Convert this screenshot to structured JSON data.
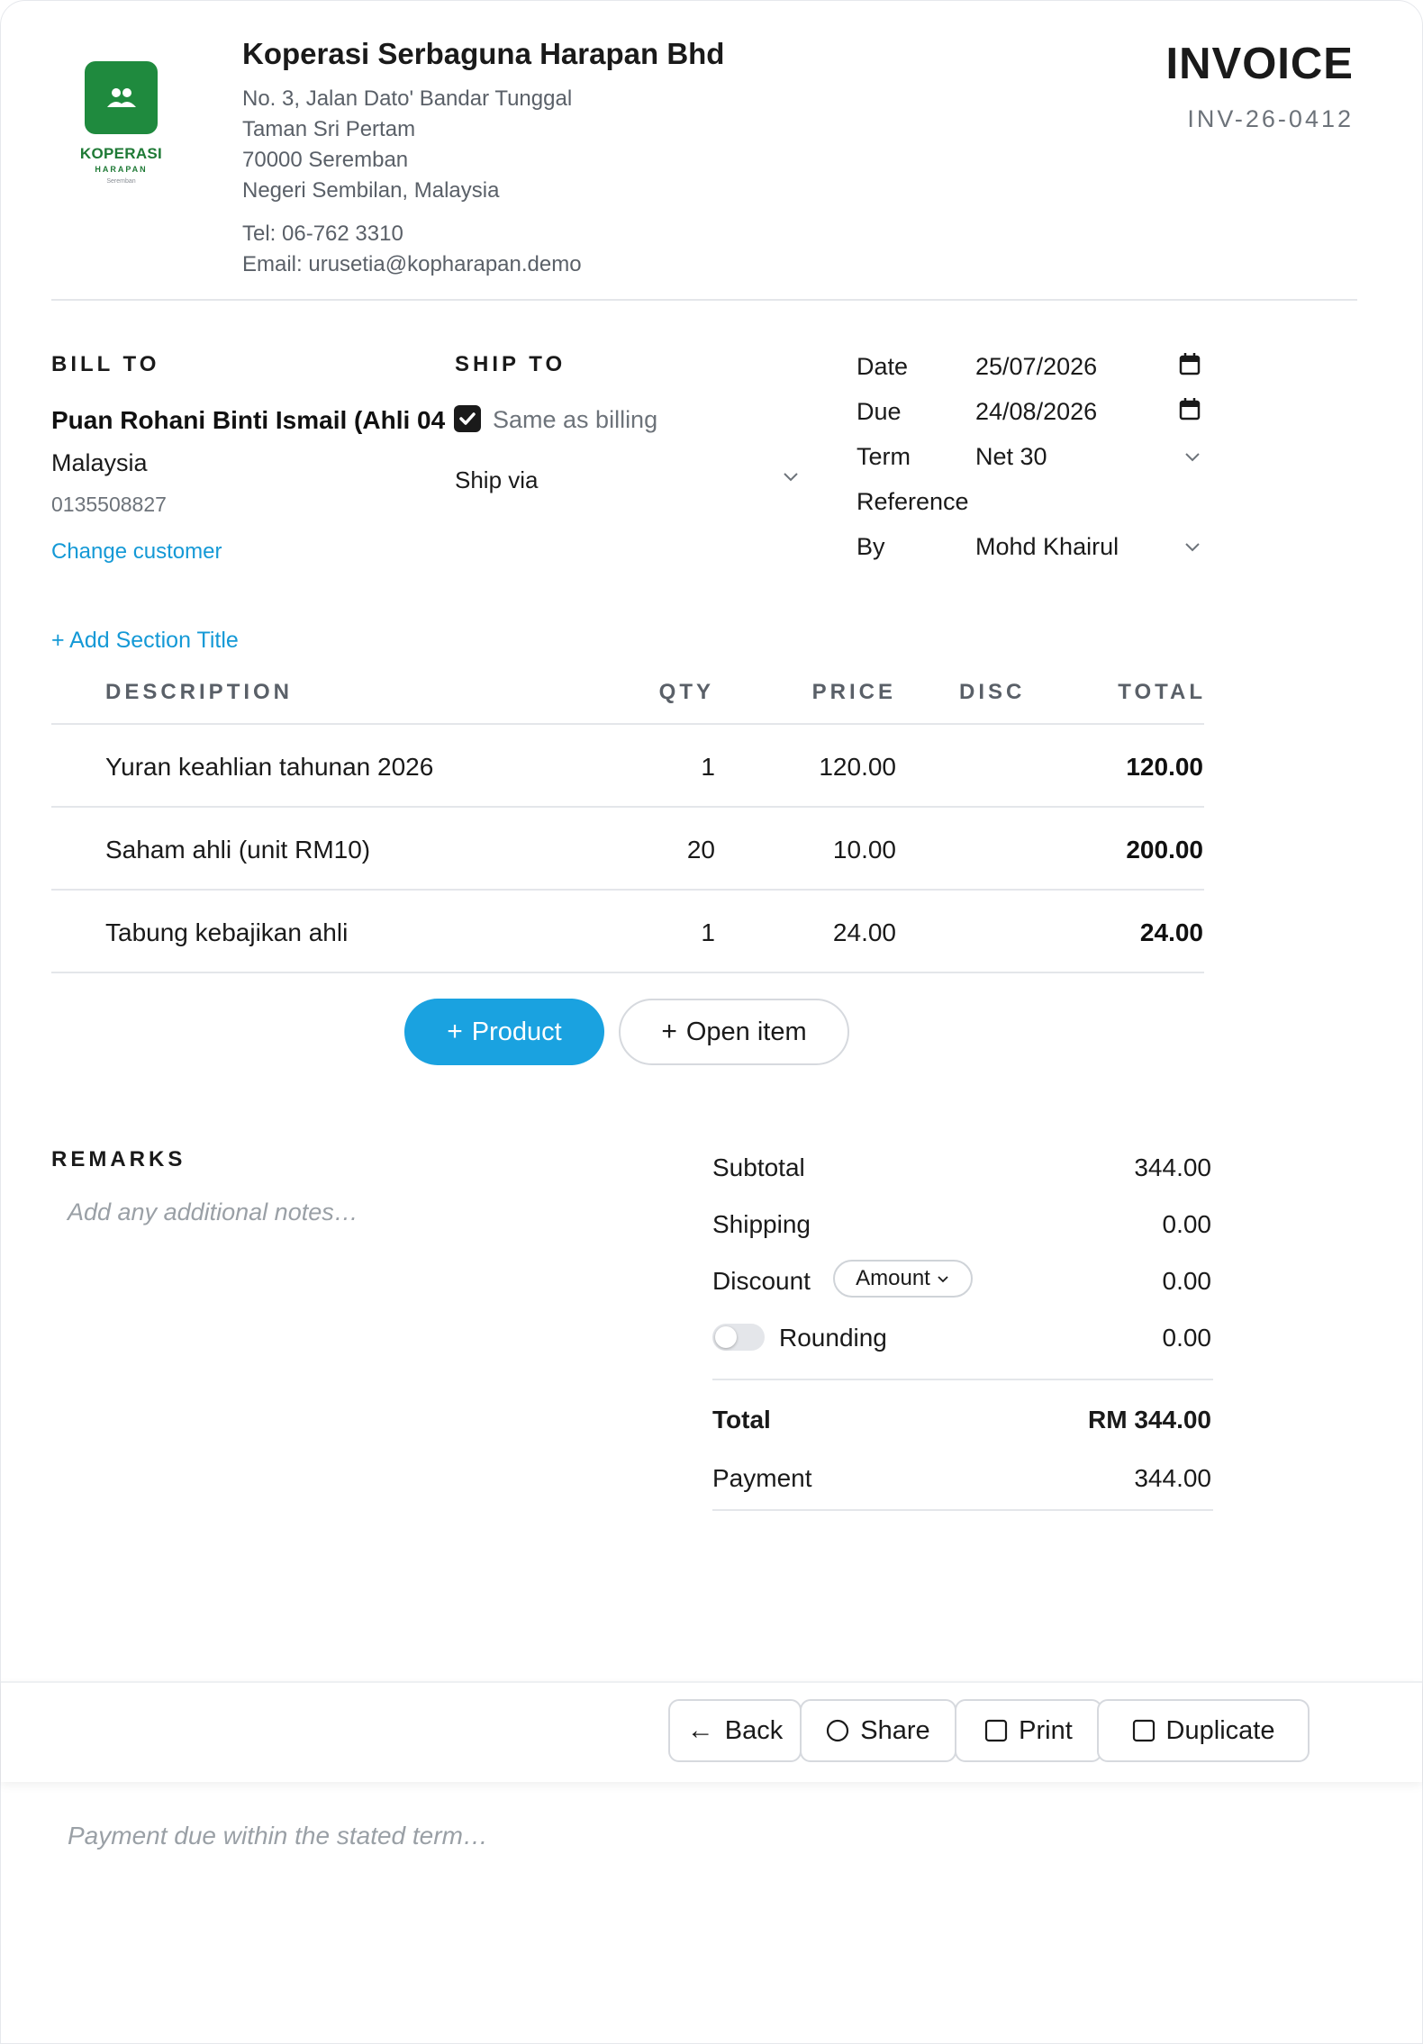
{
  "company": {
    "logo_name": "KOPERASI",
    "logo_sub": "HARAPAN",
    "logo_city": "Seremban",
    "name": "Koperasi Serbaguna Harapan Bhd",
    "address": [
      "No. 3, Jalan Dato' Bandar Tunggal",
      "Taman Sri Pertam",
      "70000 Seremban",
      "Negeri Sembilan, Malaysia"
    ],
    "tel": "Tel: 06-762 3310",
    "email": "Email: urusetia@kopharapan.demo"
  },
  "invoice": {
    "title": "INVOICE",
    "number": "INV-26-0412"
  },
  "bill_to": {
    "label": "BILL TO",
    "name": "Puan Rohani Binti Ismail (Ahli 04",
    "country": "Malaysia",
    "phone": "0135508827",
    "change_link": "Change customer"
  },
  "ship_to": {
    "label": "SHIP TO",
    "same_as_billing": "Same as billing",
    "ship_via": "Ship via"
  },
  "meta": {
    "date_label": "Date",
    "date_value": "25/07/2026",
    "due_label": "Due",
    "due_value": "24/08/2026",
    "term_label": "Term",
    "term_value": "Net 30",
    "reference_label": "Reference",
    "by_label": "By",
    "by_value": "Mohd Khairul"
  },
  "section": {
    "add_title": "+ Add Section Title"
  },
  "table": {
    "headers": {
      "description": "DESCRIPTION",
      "qty": "QTY",
      "price": "PRICE",
      "disc": "DISC",
      "total": "TOTAL"
    },
    "rows": [
      {
        "description": "Yuran keahlian tahunan 2026",
        "qty": "1",
        "price": "120.00",
        "disc": "",
        "total": "120.00"
      },
      {
        "description": "Saham ahli (unit RM10)",
        "qty": "20",
        "price": "10.00",
        "disc": "",
        "total": "200.00"
      },
      {
        "description": "Tabung kebajikan ahli",
        "qty": "1",
        "price": "24.00",
        "disc": "",
        "total": "24.00"
      }
    ]
  },
  "actions": {
    "product": "Product",
    "open_item": "Open item"
  },
  "remarks": {
    "label": "REMARKS",
    "placeholder": "Add any additional notes…"
  },
  "totals": {
    "subtotal_label": "Subtotal",
    "subtotal": "344.00",
    "shipping_label": "Shipping",
    "shipping": "0.00",
    "discount_label": "Discount",
    "discount_mode": "Amount",
    "discount": "0.00",
    "rounding_label": "Rounding",
    "rounding": "0.00",
    "rounding_enabled": false,
    "total_label": "Total",
    "total": "RM 344.00",
    "payment_label": "Payment",
    "payment": "344.00"
  },
  "footer": {
    "back": "Back",
    "share": "Share",
    "print": "Print",
    "duplicate": "Duplicate",
    "note_placeholder": "Payment due within the stated term…"
  },
  "colors": {
    "brand_green": "#1f8a3e",
    "accent_blue": "#1aa2e0",
    "link_blue": "#1499d6"
  }
}
